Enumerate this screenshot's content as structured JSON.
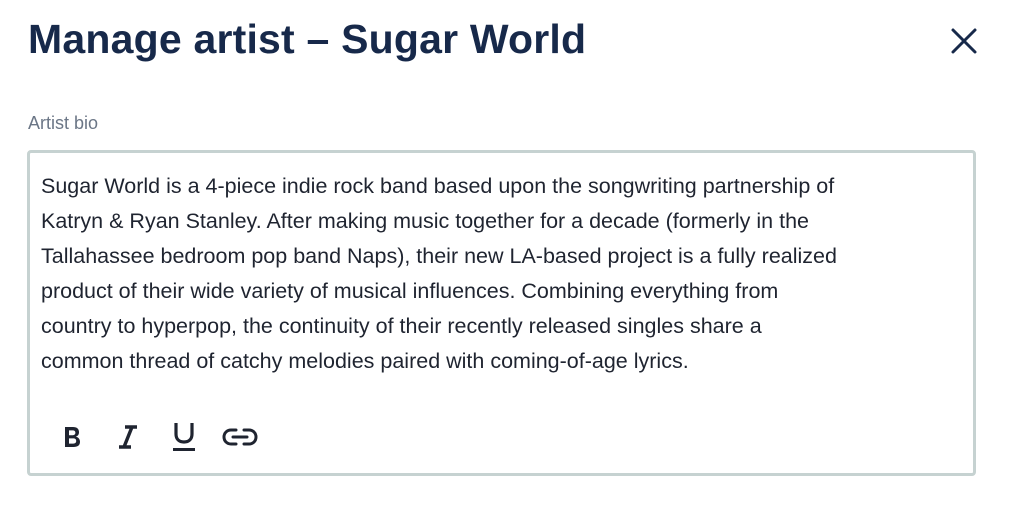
{
  "dialog": {
    "title": "Manage artist – Sugar World",
    "close_icon": "close-icon"
  },
  "bio_field": {
    "label": "Artist bio",
    "value": "Sugar World is a 4-piece indie rock band based upon the songwriting partnership of\nKatryn & Ryan Stanley. After making music together for a decade (formerly in the\nTallahassee bedroom pop band Naps), their new LA-based project is a fully realized\nproduct of their wide variety of musical influences. Combining everything from\ncountry to hyperpop, the continuity of their recently released singles share a\ncommon thread of catchy melodies paired with coming-of-age lyrics."
  },
  "toolbar": {
    "items": [
      {
        "name": "bold",
        "icon": "bold-icon"
      },
      {
        "name": "italic",
        "icon": "italic-icon"
      },
      {
        "name": "underline",
        "icon": "underline-icon"
      },
      {
        "name": "link",
        "icon": "link-icon"
      }
    ]
  },
  "colors": {
    "title": "#17294a",
    "label": "#6b7686",
    "text": "#1f2430",
    "border": "#c6d2d1"
  }
}
